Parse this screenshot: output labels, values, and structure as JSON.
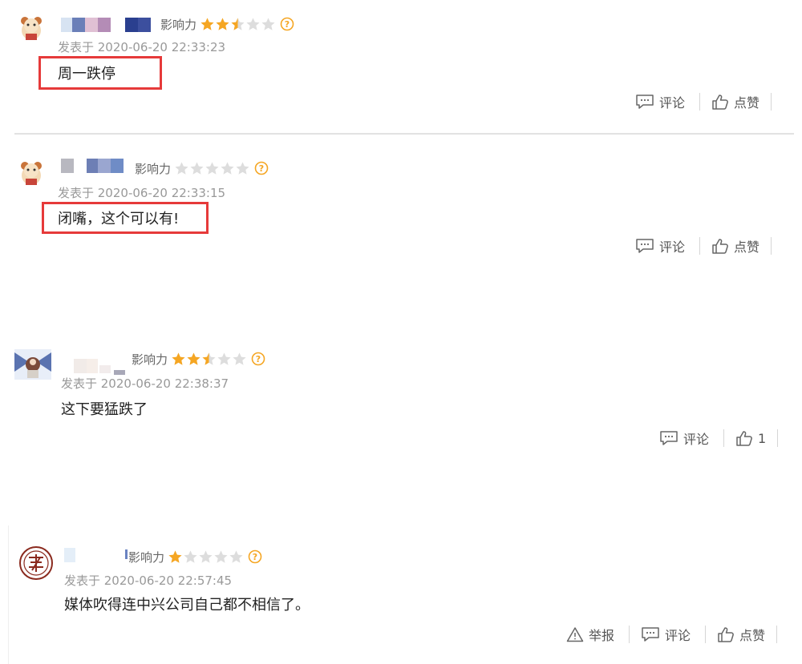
{
  "colors": {
    "star_filled": "#f5a623",
    "star_empty": "#dddddd",
    "highlight": "#e63a3a",
    "meta_text": "#999999"
  },
  "icons": {
    "star": "star-icon",
    "help": "question-circle-icon",
    "comment": "comment-bubble-icon",
    "like": "thumbs-up-icon",
    "report": "warning-triangle-icon"
  },
  "comments": [
    {
      "influence_label": "影响力",
      "rating_stars": 2.5,
      "posted": "发表于 2020-06-20 22:33:23",
      "text": "周一跌停",
      "highlighted": true,
      "actions": {
        "comment": "评论",
        "like": "点赞"
      }
    },
    {
      "influence_label": "影响力",
      "rating_stars": 0,
      "posted": "发表于 2020-06-20 22:33:15",
      "text": "闭嘴，这个可以有!",
      "highlighted": true,
      "actions": {
        "comment": "评论",
        "like": "点赞"
      }
    },
    {
      "influence_label": "影响力",
      "rating_stars": 2.5,
      "posted": "发表于 2020-06-20 22:38:37",
      "text": "这下要猛跌了",
      "highlighted": false,
      "actions": {
        "comment": "评论",
        "like": "1"
      }
    },
    {
      "influence_label": "影响力",
      "rating_stars": 1,
      "posted": "发表于 2020-06-20 22:57:45",
      "text": "媒体吹得连中兴公司自己都不相信了。",
      "highlighted": false,
      "actions": {
        "report": "举报",
        "comment": "评论",
        "like": "点赞"
      }
    }
  ]
}
